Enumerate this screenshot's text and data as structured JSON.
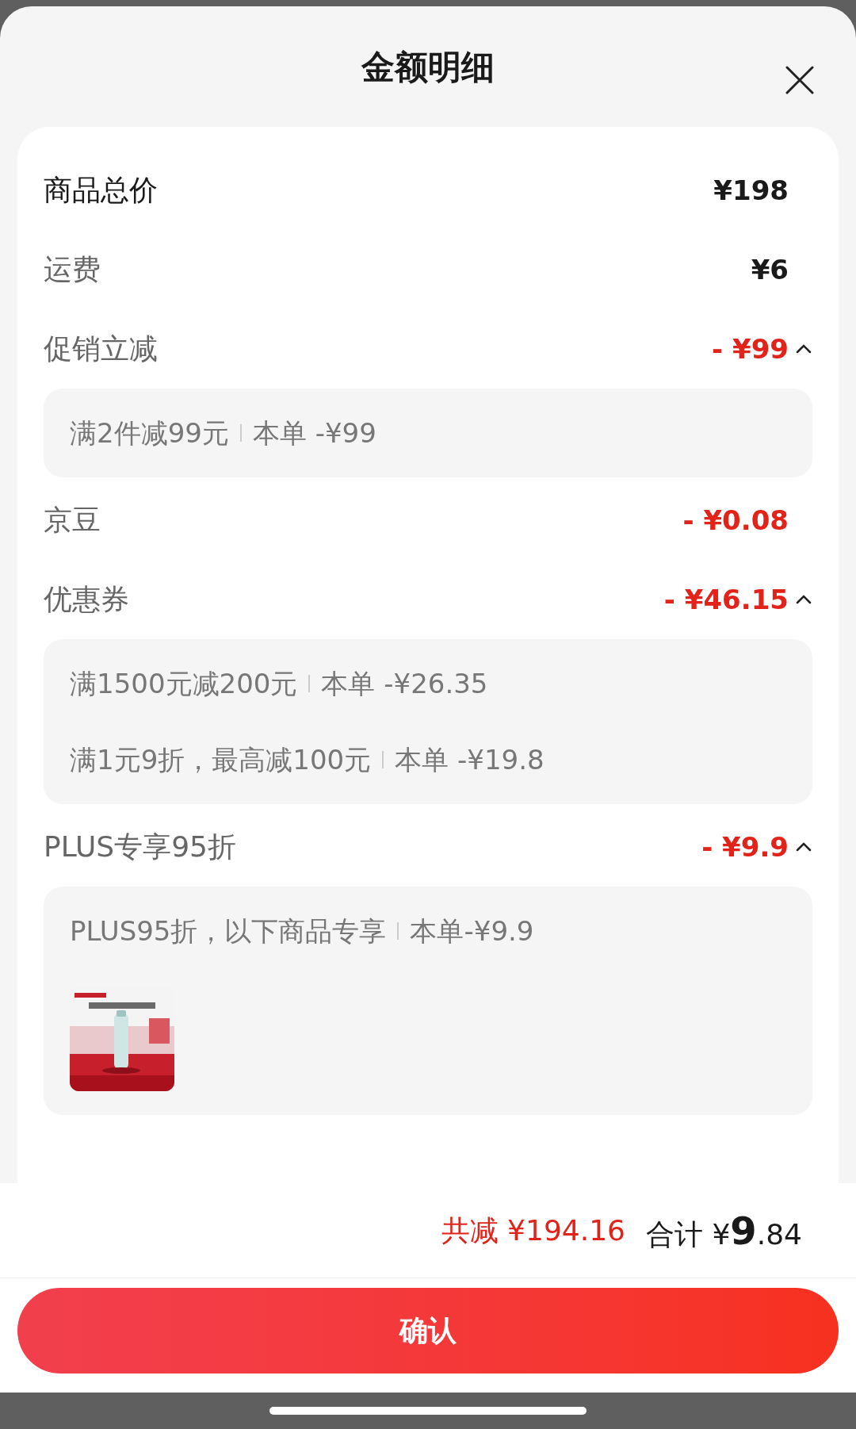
{
  "title": "金额明细",
  "rows": [
    {
      "label": "商品总价",
      "amount": "¥198",
      "kind": "price"
    },
    {
      "label": "运费",
      "amount": "¥6",
      "kind": "price"
    },
    {
      "label": "促销立减",
      "amount": "- ¥99",
      "kind": "discount",
      "expanded": true,
      "details": [
        {
          "text": "满2件减99元",
          "amount": "本单 -¥99"
        }
      ]
    },
    {
      "label": "京豆",
      "amount": "- ¥0.08",
      "kind": "discount"
    },
    {
      "label": "优惠券",
      "amount": "- ¥46.15",
      "kind": "discount",
      "expanded": true,
      "details": [
        {
          "text": "满1500元减200元",
          "amount": "本单 -¥26.35"
        },
        {
          "text": "满1元9折，最高减100元",
          "amount": "本单 -¥19.8"
        }
      ]
    },
    {
      "label": "PLUS专享95折",
      "amount": "- ¥9.9",
      "kind": "discount",
      "expanded": true,
      "details": [
        {
          "text": "PLUS95折，以下商品专享",
          "amount": "本单-¥9.9"
        }
      ],
      "products": [
        {
          "kind": "picture"
        }
      ]
    }
  ],
  "summary": {
    "saved_label": "共减",
    "saved_amount": "¥194.16",
    "total_label": "合计",
    "currency": "¥",
    "total_integer": "9",
    "total_decimal": ".84"
  },
  "confirm_button": "确认"
}
